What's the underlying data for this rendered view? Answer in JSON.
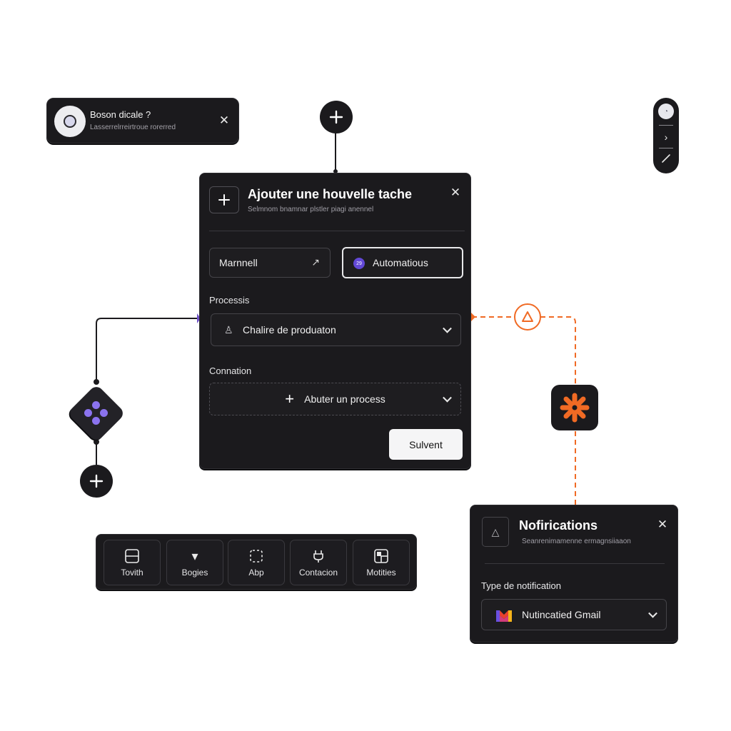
{
  "toast": {
    "title": "Boson dicale ?",
    "subtitle": "Lasserrelrreirtroue rorerred",
    "close_icon": "✕"
  },
  "task_panel": {
    "title": "Ajouter une houvelle tache",
    "subtitle": "Selmnom bnamnar plstler piagi anennel",
    "close_icon": "✕",
    "modes": {
      "manual_label": "Marnnell",
      "auto_label": "Automatious",
      "auto_badge": "29"
    },
    "process_label": "Processis",
    "process_value": "Chalire de produaton",
    "connection_label": "Connation",
    "connection_add_label": "Abuter un process",
    "submit_label": "Sulvent"
  },
  "toolbar": {
    "items": [
      {
        "label": "Tovith",
        "icon": "layout-icon"
      },
      {
        "label": "Bogies",
        "icon": "funnel-icon"
      },
      {
        "label": "Abp",
        "icon": "dashed-frame-icon"
      },
      {
        "label": "Contacion",
        "icon": "plug-icon"
      },
      {
        "label": "Motities",
        "icon": "grid-icon"
      }
    ]
  },
  "notifications": {
    "title": "Nofirications",
    "subtitle": "Seanrenimamenne ermagnsiiaaon",
    "close_icon": "✕",
    "type_label": "Type de notification",
    "selected_value": "Nutincatied Gmail"
  },
  "colors": {
    "panel_bg": "#1b1a1d",
    "accent_purple": "#8b73ee",
    "accent_orange": "#f06a24",
    "page_bg": "#ffffff"
  }
}
